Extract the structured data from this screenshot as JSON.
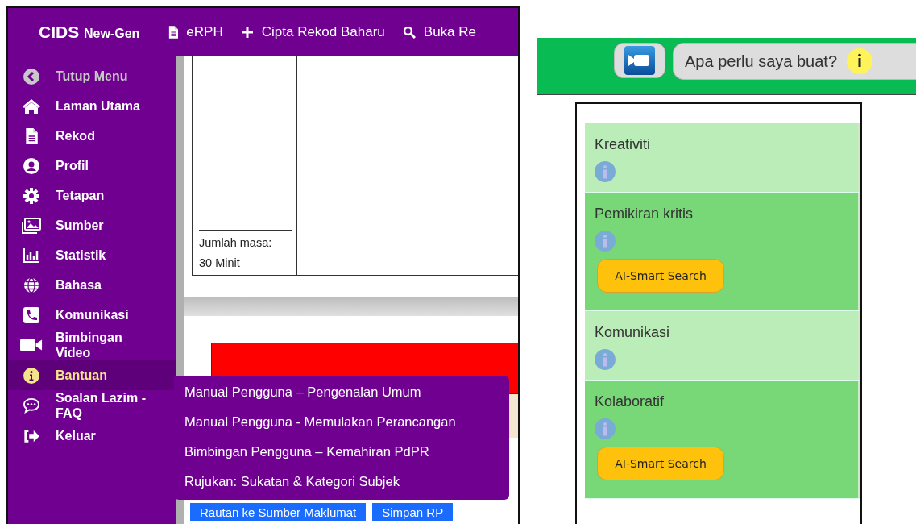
{
  "app": {
    "brand": "CIDS",
    "brand_suffix": "New-Gen",
    "top_nav": [
      "eRPH",
      "Cipta Rekod Baharu",
      "Buka Re"
    ],
    "sidebar": [
      {
        "label": "Tutup Menu",
        "kind": "collapse",
        "selected": false
      },
      {
        "label": "Laman Utama",
        "kind": "link",
        "selected": false
      },
      {
        "label": "Rekod",
        "kind": "link",
        "selected": false
      },
      {
        "label": "Profil",
        "kind": "link",
        "selected": false
      },
      {
        "label": "Tetapan",
        "kind": "link",
        "selected": false
      },
      {
        "label": "Sumber",
        "kind": "link",
        "selected": false
      },
      {
        "label": "Statistik",
        "kind": "link",
        "selected": false
      },
      {
        "label": "Bahasa",
        "kind": "link",
        "selected": false
      },
      {
        "label": "Komunikasi",
        "kind": "link",
        "selected": false
      },
      {
        "label": "Bimbingan Video",
        "kind": "link",
        "selected": false
      },
      {
        "label": "Bantuan",
        "kind": "link",
        "selected": true
      },
      {
        "label": "Soalan Lazim - FAQ",
        "kind": "link",
        "selected": false
      },
      {
        "label": "Keluar",
        "kind": "link",
        "selected": false
      }
    ],
    "submenu": [
      "Manual Pengguna – Pengenalan Umum",
      "Manual Pengguna - Memulakan Perancangan",
      "Bimbingan Pengguna – Kemahiran PdPR",
      "Rujukan: Sukatan & Kategori Subjek"
    ],
    "time_label": "Jumlah masa:",
    "time_value": "30 Minit",
    "bottom_buttons": [
      "Rautan ke Sumber Maklumat",
      "Simpan RP"
    ]
  },
  "assistant": {
    "question": "Apa perlu saya buat?",
    "skills": [
      {
        "label": "Kreativiti"
      },
      {
        "label": "Pemikiran kritis",
        "button": "AI-Smart Search"
      },
      {
        "label": "Komunikasi"
      },
      {
        "label": "Kolaboratif",
        "button": "AI-Smart Search"
      }
    ]
  }
}
